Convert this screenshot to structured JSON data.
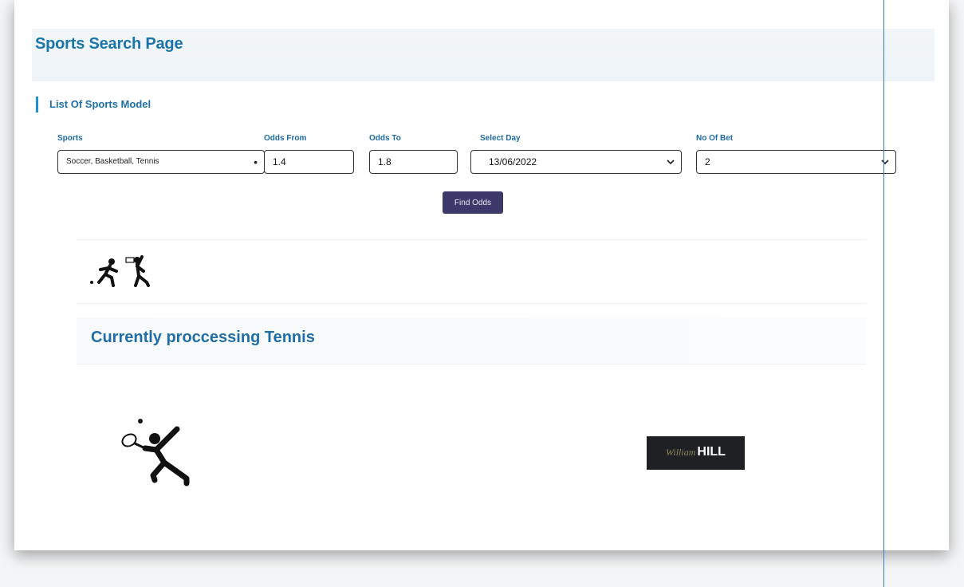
{
  "header": {
    "title": "Sports Search Page"
  },
  "section": {
    "title": "List Of Sports Model"
  },
  "filters": {
    "sports": {
      "label": "Sports",
      "value": "Soccer, Basketball, Tennis"
    },
    "odds_from": {
      "label": "Odds From",
      "value": "1.4"
    },
    "odds_to": {
      "label": "Odds To",
      "value": "1.8"
    },
    "select_day": {
      "label": "Select Day",
      "value": "13/06/2022"
    },
    "no_of_bet": {
      "label": "No Of Bet",
      "value": "2"
    }
  },
  "find_button": {
    "label": "Find Odds"
  },
  "processing": {
    "text": "Currently proccessing Tennis"
  },
  "logo": {
    "script": "William",
    "bold": "HILL"
  },
  "icons": [
    "soccer-player-icon",
    "basketball-player-icon",
    "tennis-player-icon"
  ],
  "colors": {
    "accent": "#1c75a8",
    "button": "#3d3a6b",
    "logo_bg": "#1e2024"
  }
}
